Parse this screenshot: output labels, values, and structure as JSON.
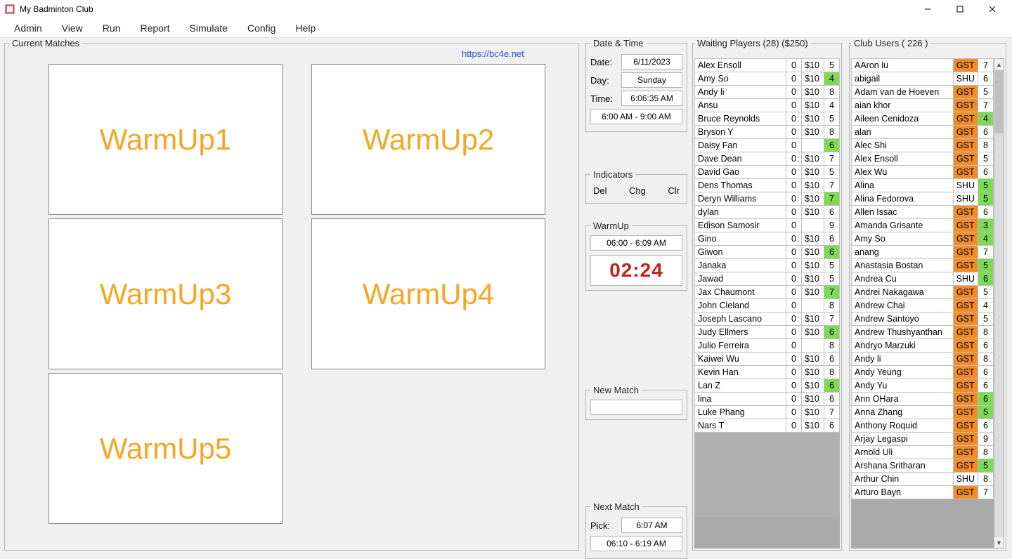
{
  "window": {
    "title": "My Badminton Club"
  },
  "menus": [
    "Admin",
    "View",
    "Run",
    "Report",
    "Simulate",
    "Config",
    "Help"
  ],
  "link": {
    "text": "https://bc4e.net"
  },
  "currentMatches": {
    "legend": "Current Matches",
    "courts": [
      "WarmUp1",
      "WarmUp2",
      "WarmUp3",
      "WarmUp4",
      "WarmUp5"
    ]
  },
  "dateTime": {
    "legend": "Date & Time",
    "dateLabel": "Date:",
    "dateVal": "6/11/2023",
    "dayLabel": "Day:",
    "dayVal": "Sunday",
    "timeLabel": "Time:",
    "timeVal": "6:06:35 AM",
    "range": "6:00 AM - 9:00 AM"
  },
  "indicators": {
    "legend": "Indicators",
    "labels": [
      "Del",
      "Chg",
      "Clr"
    ]
  },
  "warmup": {
    "legend": "WarmUp",
    "range": "06:00 - 6:09 AM",
    "clock": "02:24"
  },
  "newMatch": {
    "legend": "New Match"
  },
  "nextMatch": {
    "legend": "Next Match",
    "pickLabel": "Pick:",
    "pickVal": "6:07 AM",
    "range": "06:10 - 6:19 AM"
  },
  "waiting": {
    "legend": "Waiting Players (28) ($250)",
    "rows": [
      {
        "name": "Alex Ensoll",
        "c1": "0",
        "fee": "$10",
        "n": "5"
      },
      {
        "name": "Amy So",
        "c1": "0",
        "fee": "$10",
        "n": "4",
        "hl": true
      },
      {
        "name": "Andy li",
        "c1": "0",
        "fee": "$10",
        "n": "8"
      },
      {
        "name": "Ansu",
        "c1": "0",
        "fee": "$10",
        "n": "4"
      },
      {
        "name": "Bruce Reynolds",
        "c1": "0",
        "fee": "$10",
        "n": "5"
      },
      {
        "name": "Bryson Y",
        "c1": "0",
        "fee": "$10",
        "n": "8"
      },
      {
        "name": "Daisy Fan",
        "c1": "0",
        "fee": "",
        "n": "6",
        "hl": true
      },
      {
        "name": "Dave Dean",
        "c1": "0",
        "fee": "$10",
        "n": "7"
      },
      {
        "name": "David Gao",
        "c1": "0",
        "fee": "$10",
        "n": "5"
      },
      {
        "name": "Dens Thomas",
        "c1": "0",
        "fee": "$10",
        "n": "7"
      },
      {
        "name": "Deryn Williams",
        "c1": "0",
        "fee": "$10",
        "n": "7",
        "hl": true
      },
      {
        "name": "dylan",
        "c1": "0",
        "fee": "$10",
        "n": "6"
      },
      {
        "name": "Edison Samosir",
        "c1": "0",
        "fee": "",
        "n": "9"
      },
      {
        "name": "Gino",
        "c1": "0",
        "fee": "$10",
        "n": "6"
      },
      {
        "name": "Giwon",
        "c1": "0",
        "fee": "$10",
        "n": "6",
        "hl": true
      },
      {
        "name": "Janaka",
        "c1": "0",
        "fee": "$10",
        "n": "5"
      },
      {
        "name": "Jawad",
        "c1": "0",
        "fee": "$10",
        "n": "5"
      },
      {
        "name": "Jax Chaumont",
        "c1": "0",
        "fee": "$10",
        "n": "7",
        "hl": true
      },
      {
        "name": "John Cleland",
        "c1": "0",
        "fee": "",
        "n": "8"
      },
      {
        "name": "Joseph Lascano",
        "c1": "0",
        "fee": "$10",
        "n": "7"
      },
      {
        "name": "Judy Ellmers",
        "c1": "0",
        "fee": "$10",
        "n": "6",
        "hl": true
      },
      {
        "name": "Julio Ferreira",
        "c1": "0",
        "fee": "",
        "n": "8"
      },
      {
        "name": "Kaiwei Wu",
        "c1": "0",
        "fee": "$10",
        "n": "6"
      },
      {
        "name": "Kevin Han",
        "c1": "0",
        "fee": "$10",
        "n": "8"
      },
      {
        "name": "Lan Z",
        "c1": "0",
        "fee": "$10",
        "n": "6",
        "hl": true
      },
      {
        "name": "lina",
        "c1": "0",
        "fee": "$10",
        "n": "6"
      },
      {
        "name": "Luke Phang",
        "c1": "0",
        "fee": "$10",
        "n": "7"
      },
      {
        "name": "Nars T",
        "c1": "0",
        "fee": "$10",
        "n": "6"
      }
    ]
  },
  "users": {
    "legend": "Club Users ( 226 )",
    "rows": [
      {
        "name": "AAron lu",
        "tag": "GST",
        "tc": "gst",
        "n": "7"
      },
      {
        "name": "abigail",
        "tag": "SHU",
        "tc": "",
        "n": "6"
      },
      {
        "name": "Adam van de Hoeven",
        "tag": "GST",
        "tc": "gst",
        "n": "5"
      },
      {
        "name": "aian khor",
        "tag": "GST",
        "tc": "gst",
        "n": "7"
      },
      {
        "name": "Aileen Cenidoza",
        "tag": "GST",
        "tc": "gst",
        "n": "4",
        "hl": true
      },
      {
        "name": "alan",
        "tag": "GST",
        "tc": "gst",
        "n": "6"
      },
      {
        "name": "Alec Shi",
        "tag": "GST",
        "tc": "gst",
        "n": "8"
      },
      {
        "name": "Alex Ensoll",
        "tag": "GST",
        "tc": "gst",
        "n": "5"
      },
      {
        "name": "Alex Wu",
        "tag": "GST",
        "tc": "gst",
        "n": "6"
      },
      {
        "name": "Alina",
        "tag": "SHU",
        "tc": "",
        "n": "5",
        "hl": true
      },
      {
        "name": "Alina Fedorova",
        "tag": "SHU",
        "tc": "",
        "n": "5",
        "hl": true
      },
      {
        "name": "Allen Issac",
        "tag": "GST",
        "tc": "gst",
        "n": "6"
      },
      {
        "name": "Amanda Grisante",
        "tag": "GST",
        "tc": "gst",
        "n": "3",
        "hl": true
      },
      {
        "name": "Amy So",
        "tag": "GST",
        "tc": "gst",
        "n": "4",
        "hl": true
      },
      {
        "name": "anang",
        "tag": "GST",
        "tc": "gst",
        "n": "7"
      },
      {
        "name": "Anastasia Bostan",
        "tag": "GST",
        "tc": "gst",
        "n": "5",
        "hl": true
      },
      {
        "name": "Andrea Cu",
        "tag": "SHU",
        "tc": "",
        "n": "6",
        "hl": true
      },
      {
        "name": "Andrei Nakagawa",
        "tag": "GST",
        "tc": "gst",
        "n": "5"
      },
      {
        "name": "Andrew Chai",
        "tag": "GST",
        "tc": "gst",
        "n": "4"
      },
      {
        "name": "Andrew Santoyo",
        "tag": "GST",
        "tc": "gst",
        "n": "5"
      },
      {
        "name": "Andrew Thushyanthan",
        "tag": "GST",
        "tc": "gst",
        "n": "8"
      },
      {
        "name": "Andryo Marzuki",
        "tag": "GST",
        "tc": "gst",
        "n": "6"
      },
      {
        "name": "Andy li",
        "tag": "GST",
        "tc": "gst",
        "n": "8"
      },
      {
        "name": "Andy Yeung",
        "tag": "GST",
        "tc": "gst",
        "n": "6"
      },
      {
        "name": "Andy Yu",
        "tag": "GST",
        "tc": "gst",
        "n": "6"
      },
      {
        "name": "Ann OHara",
        "tag": "GST",
        "tc": "gst",
        "n": "6",
        "hl": true
      },
      {
        "name": "Anna Zhang",
        "tag": "GST",
        "tc": "gst",
        "n": "5",
        "hl": true
      },
      {
        "name": "Anthony Roquid",
        "tag": "GST",
        "tc": "gst",
        "n": "6"
      },
      {
        "name": "Arjay Legaspi",
        "tag": "GST",
        "tc": "gst",
        "n": "9"
      },
      {
        "name": "Arnold Uli",
        "tag": "GST",
        "tc": "gst",
        "n": "8"
      },
      {
        "name": "Arshana Sritharan",
        "tag": "GST",
        "tc": "gst",
        "n": "5",
        "hl": true
      },
      {
        "name": "Arthur Chin",
        "tag": "SHU",
        "tc": "",
        "n": "8"
      },
      {
        "name": "Arturo Bayn",
        "tag": "GST",
        "tc": "gst",
        "n": "7"
      }
    ]
  }
}
